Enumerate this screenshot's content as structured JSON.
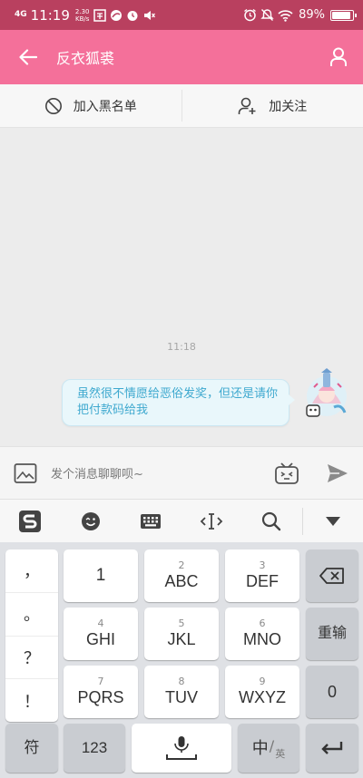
{
  "status_bar": {
    "signal": "4G",
    "time": "11:19",
    "speed_value": "2.30",
    "speed_unit": "KB/s",
    "battery": "89%",
    "battery_level": 0.89
  },
  "header": {
    "title": "反衣狐裘"
  },
  "actions": {
    "block_label": "加入黑名单",
    "follow_label": "加关注"
  },
  "chat": {
    "timestamp": "11:18",
    "message": "虽然很不情愿给恶俗发奖，但还是请你把付款码给我"
  },
  "input": {
    "placeholder": "发个消息聊聊呗~"
  },
  "keyboard": {
    "punctuation": [
      "，",
      "。",
      "？",
      "！"
    ],
    "row1": [
      {
        "num": "",
        "label": "1"
      },
      {
        "num": "2",
        "label": "ABC"
      },
      {
        "num": "3",
        "label": "DEF"
      }
    ],
    "row2": [
      {
        "num": "4",
        "label": "GHI"
      },
      {
        "num": "5",
        "label": "JKL"
      },
      {
        "num": "6",
        "label": "MNO"
      }
    ],
    "row3": [
      {
        "num": "7",
        "label": "PQRS"
      },
      {
        "num": "8",
        "label": "TUV"
      },
      {
        "num": "9",
        "label": "WXYZ"
      }
    ],
    "reenter_label": "重输",
    "zero_label": "0",
    "symbol_label": "符",
    "numbers_label": "123",
    "lang_main": "中",
    "lang_sub": "英"
  },
  "colors": {
    "header": "#f4709a",
    "status_bar": "#b9405f",
    "bubble_text": "#3fa9cf"
  }
}
